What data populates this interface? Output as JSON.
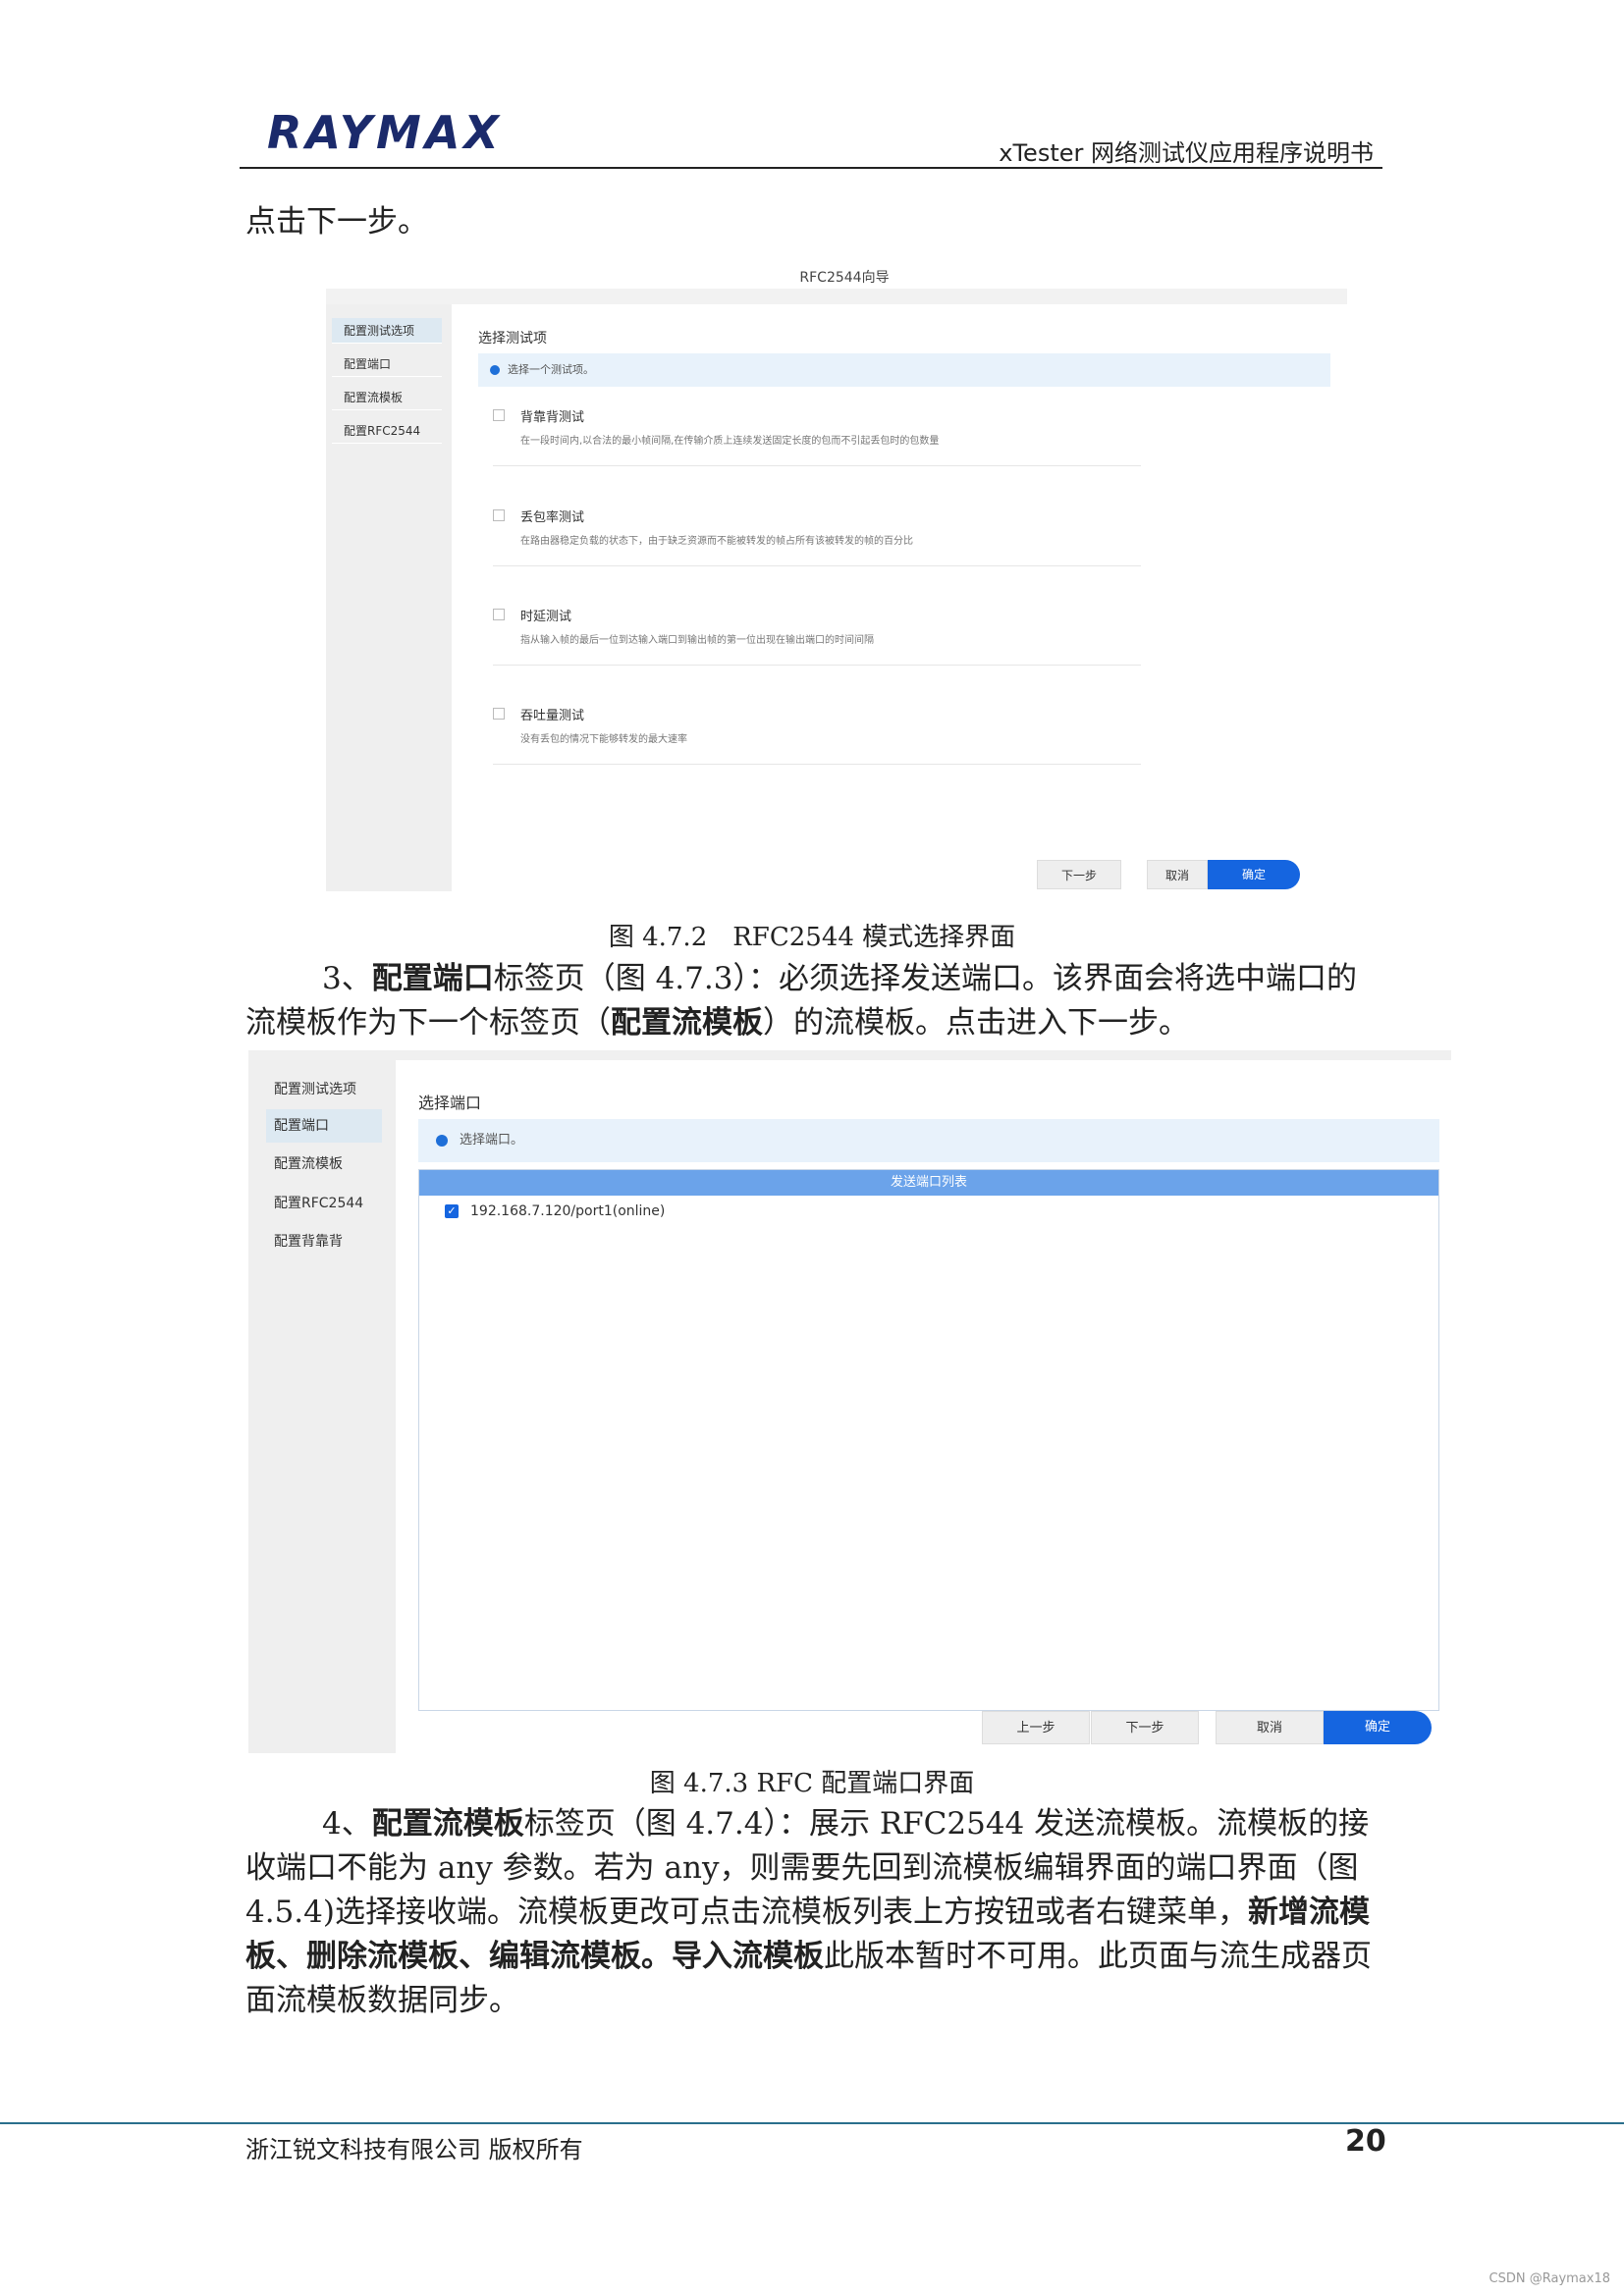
{
  "header": {
    "logo_text": "RAYMAX",
    "doc_title": "xTester 网络测试仪应用程序说明书"
  },
  "intro": "点击下一步。",
  "figure1": {
    "window_title": "RFC2544向导",
    "sidebar": [
      "配置测试选项",
      "配置端口",
      "配置流模板",
      "配置RFC2544"
    ],
    "section_title": "选择测试项",
    "info": "选择一个测试项。",
    "options": [
      {
        "label": "背靠背测试",
        "desc": "在一段时间内,以合法的最小帧间隔,在传输介质上连续发送固定长度的包而不引起丢包时的包数量"
      },
      {
        "label": "丢包率测试",
        "desc": "在路由器稳定负载的状态下，由于缺乏资源而不能被转发的帧占所有该被转发的帧的百分比"
      },
      {
        "label": "时延测试",
        "desc": "指从输入帧的最后一位到达输入端口到输出帧的第一位出现在输出端口的时间间隔"
      },
      {
        "label": "吞吐量测试",
        "desc": "没有丢包的情况下能够转发的最大速率"
      }
    ],
    "buttons": {
      "next": "下一步",
      "cancel": "取消",
      "ok": "确定"
    },
    "caption": "图 4.7.2　RFC2544 模式选择界面"
  },
  "para3": {
    "prefix": "3、",
    "bold1": "配置端口",
    "text1": "标签页（图 4.7.3）：必须选择发送端口。该界面会将选中端口的流模板作为下一个标签页（",
    "bold2": "配置流模板",
    "text2": "）的流模板。点击进入下一步。"
  },
  "figure2": {
    "sidebar": [
      "配置测试选项",
      "配置端口",
      "配置流模板",
      "配置RFC2544",
      "配置背靠背"
    ],
    "section_title": "选择端口",
    "info": "选择端口。",
    "list_header": "发送端口列表",
    "port": "192.168.7.120/port1(online)",
    "buttons": {
      "prev": "上一步",
      "next": "下一步",
      "cancel": "取消",
      "ok": "确定"
    },
    "caption": "图 4.7.3 RFC 配置端口界面"
  },
  "para4": {
    "prefix": "4、",
    "bold1": "配置流模板",
    "text1": "标签页（图 4.7.4）：展示 RFC2544 发送流模板。流模板的接收端口不能为 any 参数。若为 any，则需要先回到流模板编辑界面的端口界面（图 4.5.4)选择接收端。流模板更改可点击流模板列表上方按钮或者右键菜单，",
    "bold2": "新增流模板、删除流模板、编辑流模板。导入流模板",
    "text2": "此版本暂时不可用。此页面与流生成器页面流模板数据同步。"
  },
  "footer": {
    "company": "浙江锐文科技有限公司 版权所有",
    "page": "20",
    "watermark": "CSDN @Raymax18"
  }
}
